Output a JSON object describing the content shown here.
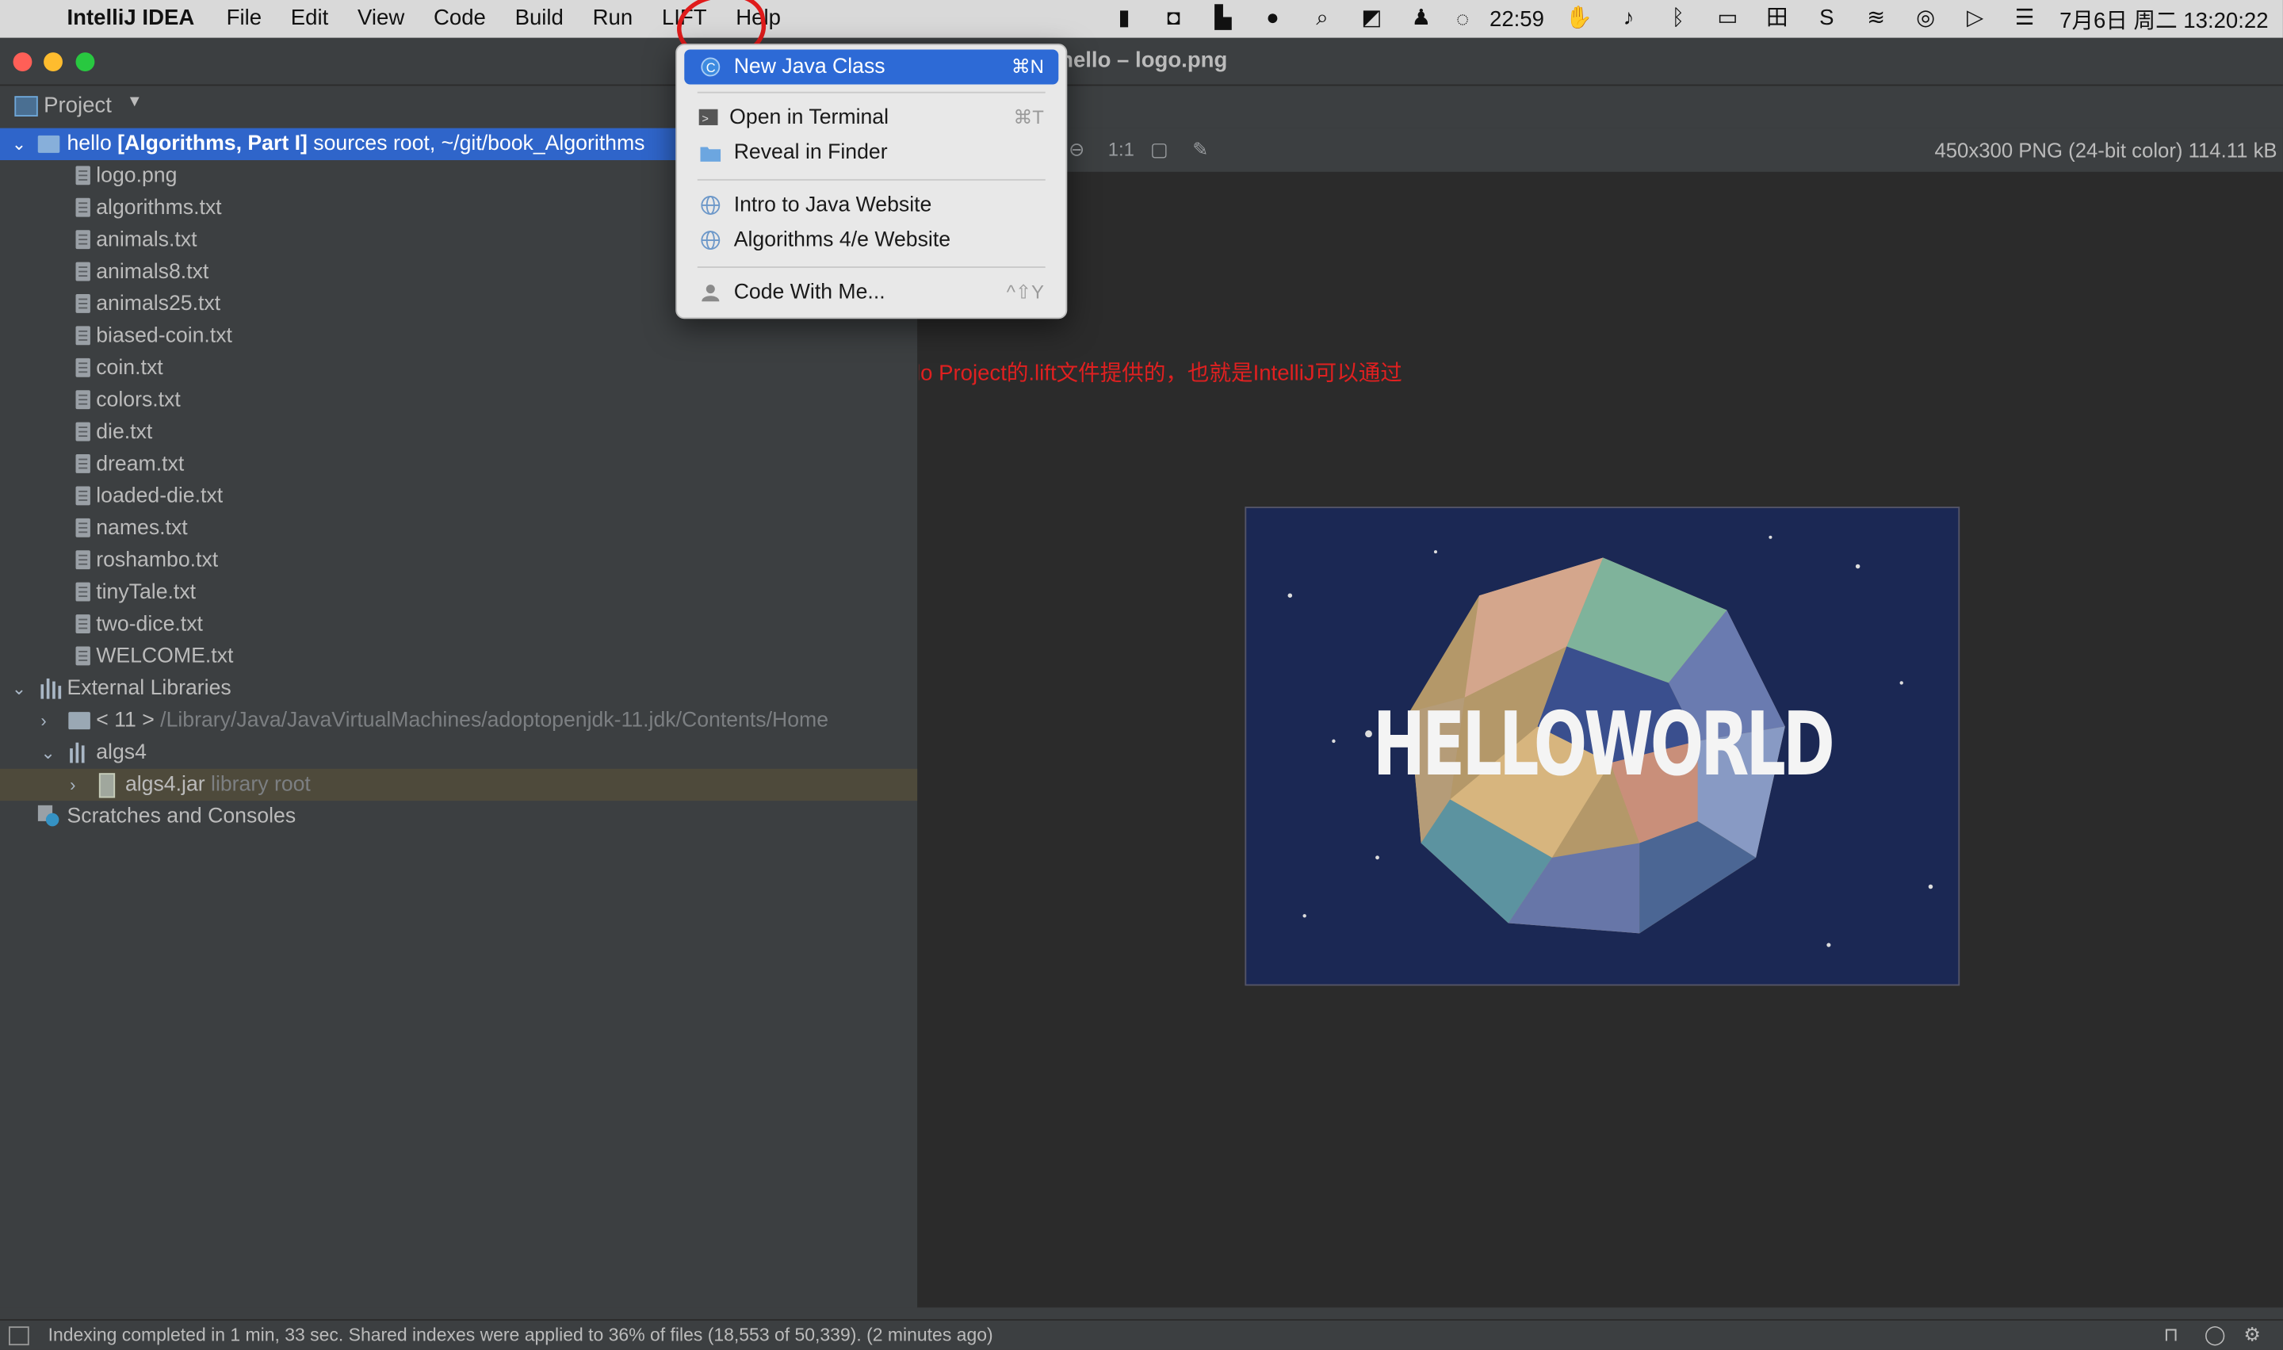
{
  "menubar": {
    "app_name": "IntelliJ IDEA",
    "items": [
      "File",
      "Edit",
      "View",
      "Code",
      "Build",
      "Run",
      "LIFT",
      "Help"
    ],
    "time_left": "22:59",
    "datetime": "7月6日 周二  13:20:22"
  },
  "window": {
    "title": "hello – logo.png"
  },
  "project_panel": {
    "header": "Project",
    "root": {
      "name": "hello",
      "bold": "[Algorithms, Part I]",
      "suffix": " sources root,  ~/git/book_Algorithms"
    },
    "files": [
      "logo.png",
      "algorithms.txt",
      "animals.txt",
      "animals8.txt",
      "animals25.txt",
      "biased-coin.txt",
      "coin.txt",
      "colors.txt",
      "die.txt",
      "dream.txt",
      "loaded-die.txt",
      "names.txt",
      "roshambo.txt",
      "tinyTale.txt",
      "two-dice.txt",
      "WELCOME.txt"
    ],
    "external_libraries": "External Libraries",
    "jdk": {
      "name": "< 11 >",
      "path": "/Library/Java/JavaVirtualMachines/adoptopenjdk-11.jdk/Contents/Home"
    },
    "algs4": "algs4",
    "algs4_jar": {
      "name": "algs4.jar",
      "note": "library root"
    },
    "scratches": "Scratches and Consoles"
  },
  "editor": {
    "image_info": "450x300 PNG (24-bit color) 114.11 kB",
    "zoom_label": "1:1",
    "image_text": "HELLOWORLD",
    "annotation": "这个LIFT菜单是这个hello Project的.lift文件提供的，也就是IntelliJ可以通过"
  },
  "lift_menu": {
    "items": [
      {
        "label": "New Java Class",
        "shortcut": "⌘N",
        "icon": "java-class-icon"
      },
      {
        "label": "Open in Terminal",
        "shortcut": "⌘T",
        "icon": "terminal-icon"
      },
      {
        "label": "Reveal in Finder",
        "shortcut": "",
        "icon": "folder-icon"
      },
      {
        "label": "Intro to Java Website",
        "shortcut": "",
        "icon": "globe-icon"
      },
      {
        "label": "Algorithms 4/e Website",
        "shortcut": "",
        "icon": "globe-icon"
      },
      {
        "label": "Code With Me...",
        "shortcut": "^⇧Y",
        "icon": "user-icon"
      }
    ]
  },
  "status_bar": {
    "message": "Indexing completed in 1 min, 33 sec. Shared indexes were applied to 36% of files (18,553 of 50,339). (2 minutes ago)"
  },
  "colors": {
    "accent": "#2f65ca",
    "annotation": "#e02020",
    "panel_bg": "#3c3f41",
    "editor_bg": "#2b2b2b"
  }
}
